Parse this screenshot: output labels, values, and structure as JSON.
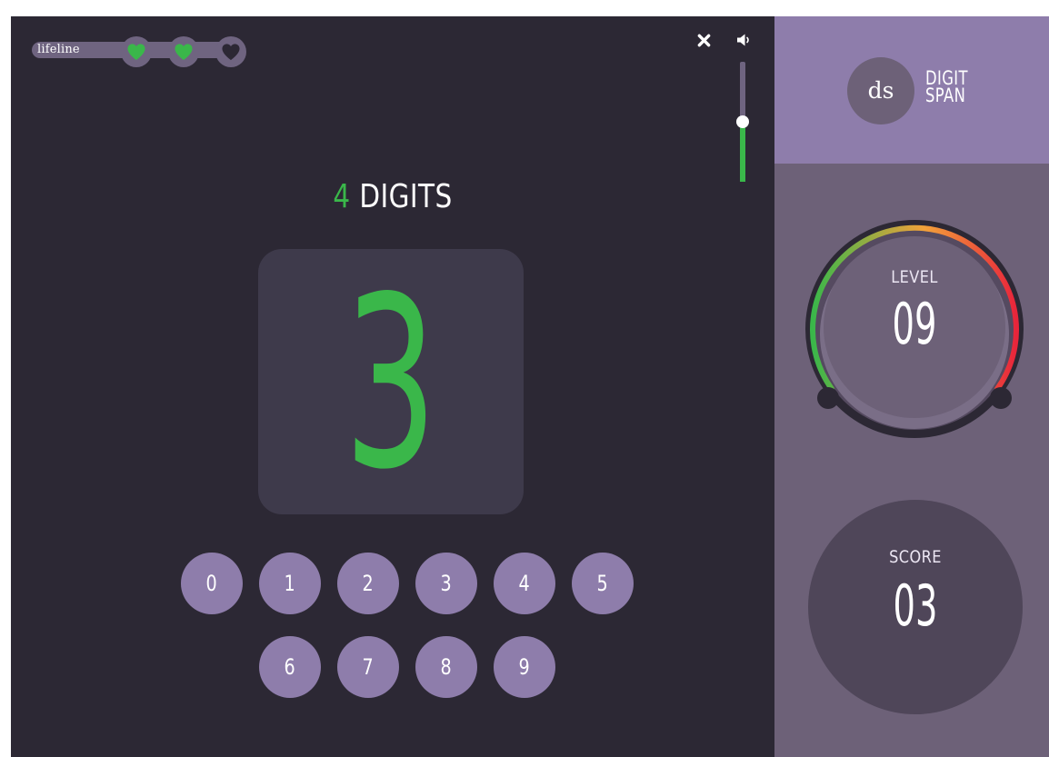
{
  "lifeline": {
    "label": "lifeline",
    "hearts": [
      {
        "state": "full",
        "icon": "heart-icon"
      },
      {
        "state": "full",
        "icon": "heart-icon"
      },
      {
        "state": "empty",
        "icon": "heart-icon"
      }
    ]
  },
  "controls": {
    "close_icon": "close-icon",
    "sound_icon": "speaker-icon",
    "volume_level": 0.5
  },
  "heading": {
    "count": "4",
    "label": "DIGITS"
  },
  "current_digit": "3",
  "keypad": {
    "row1": [
      "0",
      "1",
      "2",
      "3",
      "4",
      "5"
    ],
    "row2": [
      "6",
      "7",
      "8",
      "9"
    ]
  },
  "brand": {
    "badge": "ds",
    "name_line1": "DIGIT",
    "name_line2": "SPAN"
  },
  "level": {
    "label": "LEVEL",
    "value": "09"
  },
  "score": {
    "label": "SCORE",
    "value": "03"
  },
  "colors": {
    "background": "#2c2834",
    "accent_green": "#3ab74a",
    "key_purple": "#8e7dab",
    "panel": "#6d6178",
    "gauge_gradient": [
      "#3ab74a",
      "#f2a13a",
      "#e8253b"
    ]
  }
}
